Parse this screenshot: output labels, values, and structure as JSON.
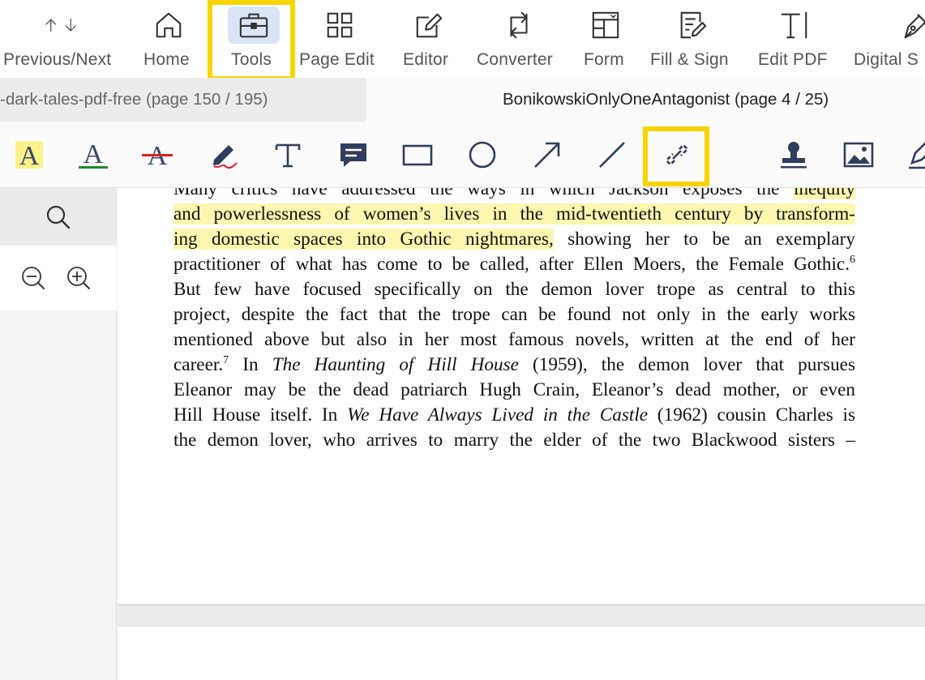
{
  "toolbar": {
    "tools": [
      {
        "id": "prevnext",
        "label": "Previous/Next"
      },
      {
        "id": "home",
        "label": "Home"
      },
      {
        "id": "tools",
        "label": "Tools"
      },
      {
        "id": "page_edit",
        "label": "Page Edit"
      },
      {
        "id": "editor",
        "label": "Editor"
      },
      {
        "id": "converter",
        "label": "Converter"
      },
      {
        "id": "form",
        "label": "Form"
      },
      {
        "id": "fill_sign",
        "label": "Fill & Sign"
      },
      {
        "id": "edit_pdf",
        "label": "Edit PDF"
      },
      {
        "id": "digital",
        "label": "Digital S"
      }
    ],
    "active_tool": "Tools"
  },
  "tabs": {
    "inactive": "-dark-tales-pdf-free (page 150 / 195)",
    "active": "BonikowskiOnlyOneAntagonist (page 4 / 25)"
  },
  "annotation_tools": [
    "highlight-text",
    "underline-text",
    "strikethrough-text",
    "pencil",
    "text-box",
    "comment",
    "rectangle",
    "ellipse",
    "arrow",
    "line",
    "link",
    "stamp",
    "image",
    "signature"
  ],
  "colors": {
    "highlight_box": "#f8d400",
    "text_highlight": "#fdf7b0",
    "underline_green": "#1a8a2a",
    "strike_red": "#e02020",
    "active_tool_bg": "#d9e5f7"
  },
  "document": {
    "line1_a": "Many critics have addressed the ways in which Jackson exposes the ",
    "line1_hl": "inequity",
    "line2": "and powerlessness of women’s lives in the mid-twentieth century by transform-",
    "line3_hl": "ing domestic spaces into Gothic nightmares,",
    "line3_b": " showing her to be an exemplary",
    "line4": "practitioner of what has come to be called, after Ellen Moers, the Female Gothic.",
    "fn6": "6",
    "line5": "But few have focused specifically on the demon lover trope as central to this",
    "line6": "project, despite the fact that the trope can be found not only in the early works",
    "line7": "mentioned above but also in her most famous novels, written at the end of her",
    "line8_a": "career.",
    "fn7": "7",
    "line8_b": " In ",
    "line8_title": "The Haunting of Hill House",
    "line8_c": " (1959), the demon lover that pursues",
    "line9": "Eleanor may be the dead patriarch Hugh Crain, Eleanor’s dead mother, or even",
    "line10_a": "Hill House itself. In ",
    "line10_title": "We Have Always Lived in the Castle",
    "line10_b": " (1962) cousin Charles is",
    "line11": "the demon lover, who arrives to marry the elder of the two Blackwood sisters –"
  }
}
